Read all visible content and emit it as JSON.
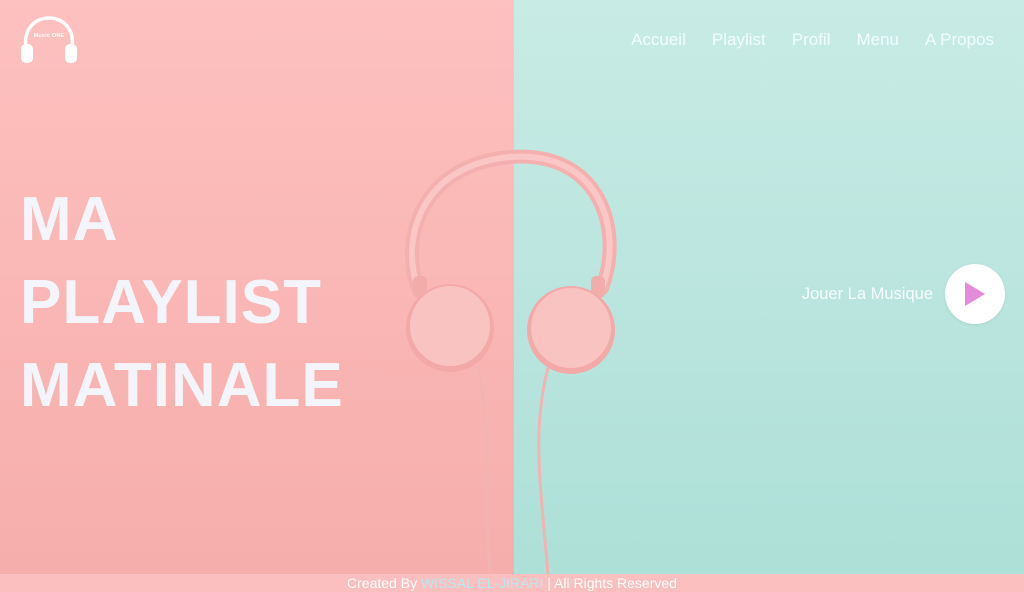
{
  "brand": {
    "logo_text": "Music ONE"
  },
  "nav": {
    "items": [
      "Accueil",
      "Playlist",
      "Profil",
      "Menu",
      "A Propos"
    ]
  },
  "hero": {
    "line1": "MA",
    "line2": "PLAYLIST",
    "line3": "MATINALE"
  },
  "player": {
    "label": "Jouer La Musique"
  },
  "footer": {
    "prefix": "Created By",
    "author": "WISSAL EL-JIRARI",
    "suffix": "| All Rights Reserved"
  },
  "colors": {
    "left_bg": "#f9b5b3",
    "right_bg": "#b8e4dd",
    "play_icon": "#e48bd9",
    "footer_bg": "#fbbfbf",
    "author": "#b3eaf1"
  },
  "icons": {
    "logo": "headphones-icon",
    "play": "play-icon"
  }
}
